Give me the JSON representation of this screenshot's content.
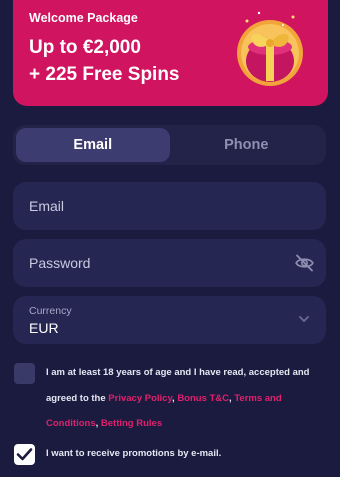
{
  "banner": {
    "kicker": "Welcome Package",
    "line1": "Up to €2,000",
    "line2": "+ 225 Free Spins",
    "color": "#d0145f"
  },
  "tabs": [
    {
      "label": "Email",
      "active": true
    },
    {
      "label": "Phone",
      "active": false
    }
  ],
  "form": {
    "email_placeholder": "Email",
    "password_placeholder": "Password",
    "currency_label": "Currency",
    "currency_value": "EUR"
  },
  "terms": {
    "checked": false,
    "text_before": "I am at least 18 years of age and I have read, accepted and agreed to the ",
    "link_privacy": "Privacy Policy",
    "sep1": ", ",
    "link_bonus": "Bonus T&C",
    "sep2": ", ",
    "link_terms": "Terms and Conditions",
    "sep3": ", ",
    "link_betting": "Betting Rules"
  },
  "promo": {
    "checked": true,
    "text": "I want to receive promotions by e-mail."
  },
  "icons": {
    "gift": "gift-box-icon",
    "eye": "eye-off-icon",
    "chevron": "chevron-down-icon",
    "check": "check-icon"
  },
  "colors": {
    "background": "#1b1b40",
    "accent": "#d0145f",
    "link": "#e0206c",
    "field": "#262653"
  }
}
